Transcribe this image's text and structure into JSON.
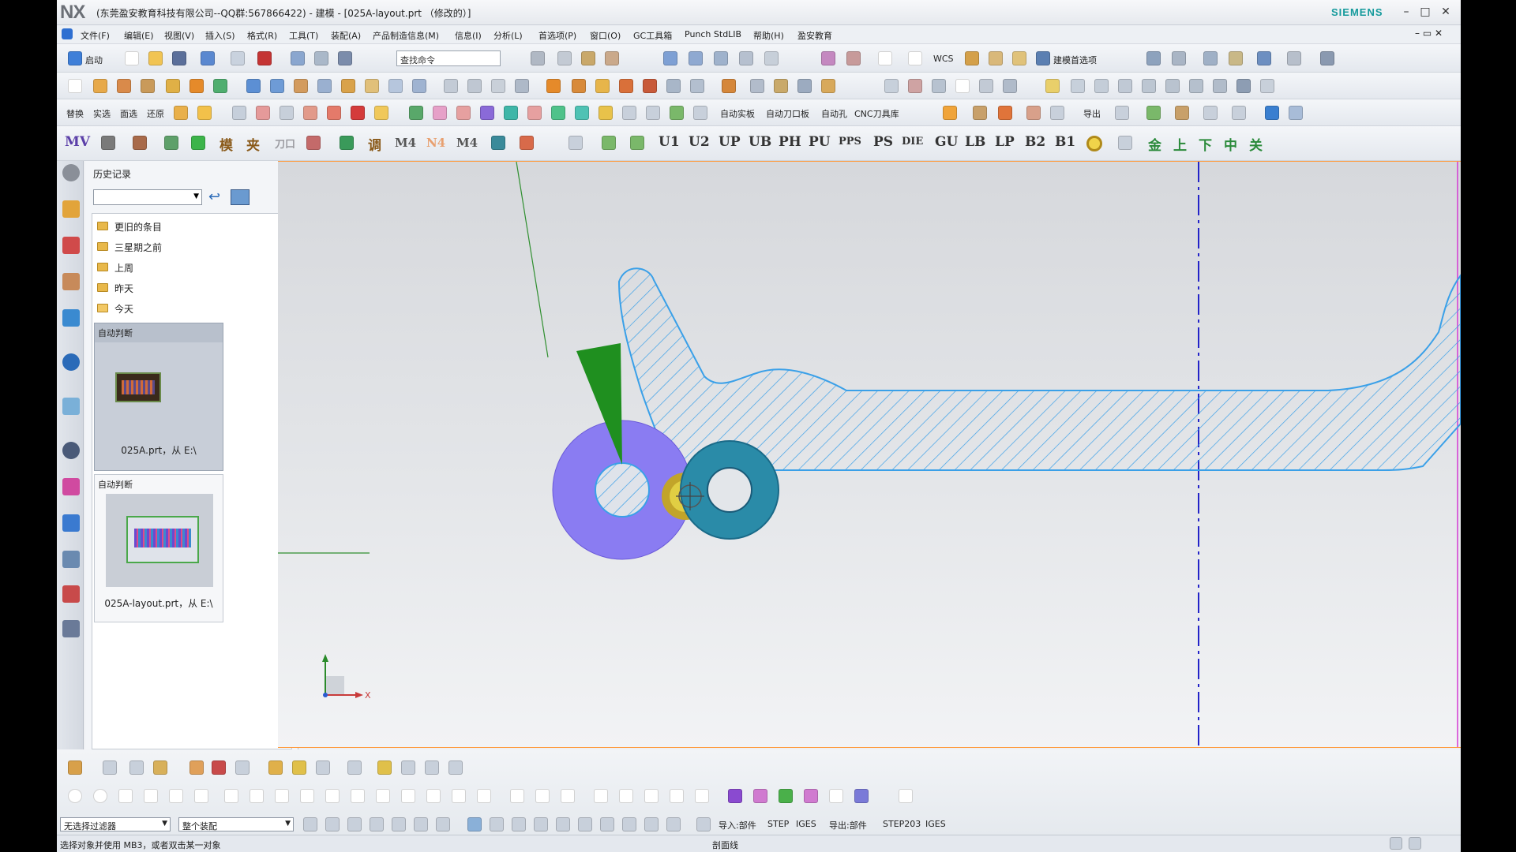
{
  "app": {
    "logo": "NX",
    "title": "(东莞盈安教育科技有限公司--QQ群:567866422) - 建模 - [025A-layout.prt （修改的）]",
    "brand": "SIEMENS"
  },
  "menu": [
    "文件(F)",
    "编辑(E)",
    "视图(V)",
    "插入(S)",
    "格式(R)",
    "工具(T)",
    "装配(A)",
    "产品制造信息(M)",
    "信息(I)",
    "分析(L)",
    "首选项(P)",
    "窗口(O)",
    "GC工具箱",
    "Punch StdLIB",
    "帮助(H)",
    "盈安教育"
  ],
  "toolbar1": {
    "start_label": "启动",
    "search_placeholder": "查找命令",
    "wcs_label": "WCS",
    "pref_label": "建模首选项"
  },
  "toolbar3_labels": [
    "替换",
    "实选",
    "面选",
    "还原",
    "自动实板",
    "自动刀口板",
    "自动孔",
    "CNC刀具库",
    "导出"
  ],
  "toolbar4_labels": [
    "MV",
    "模",
    "夹",
    "刀口",
    "调",
    "M4",
    "N4",
    "M4",
    "U1",
    "U2",
    "UP",
    "UB",
    "PH",
    "PU",
    "PPS",
    "PS",
    "DIE",
    "GU",
    "LB",
    "LP",
    "B2",
    "B1",
    "金",
    "上",
    "下",
    "中",
    "关"
  ],
  "history": {
    "title": "历史记录",
    "folders": [
      "更旧的条目",
      "三星期之前",
      "上周",
      "昨天",
      "今天"
    ],
    "cards": [
      {
        "header": "自动判断",
        "name": "025A.prt，从 E:\\"
      },
      {
        "header": "自动判断",
        "name": "025A-layout.prt，从 E:\\"
      }
    ]
  },
  "bottom": {
    "filter": "无选择过滤器",
    "assembly": "整个装配",
    "import_labels": [
      "导入:部件",
      "STEP",
      "IGES",
      "导出:部件",
      "STEP203",
      "IGES"
    ]
  },
  "status": {
    "left": "选择对象并使用 MB3，或者双击某一对象",
    "middle": "剖面线"
  },
  "axis_label": "X",
  "colors": {
    "accent_blue": "#2e6fd1",
    "hatch": "#3aa0e8",
    "gear_big": "#8a7cf2",
    "gear_small": "#2a8ba8",
    "arrow": "#1f8f1f",
    "centerline": "#2323c8",
    "magenta": "#d43ad4"
  }
}
